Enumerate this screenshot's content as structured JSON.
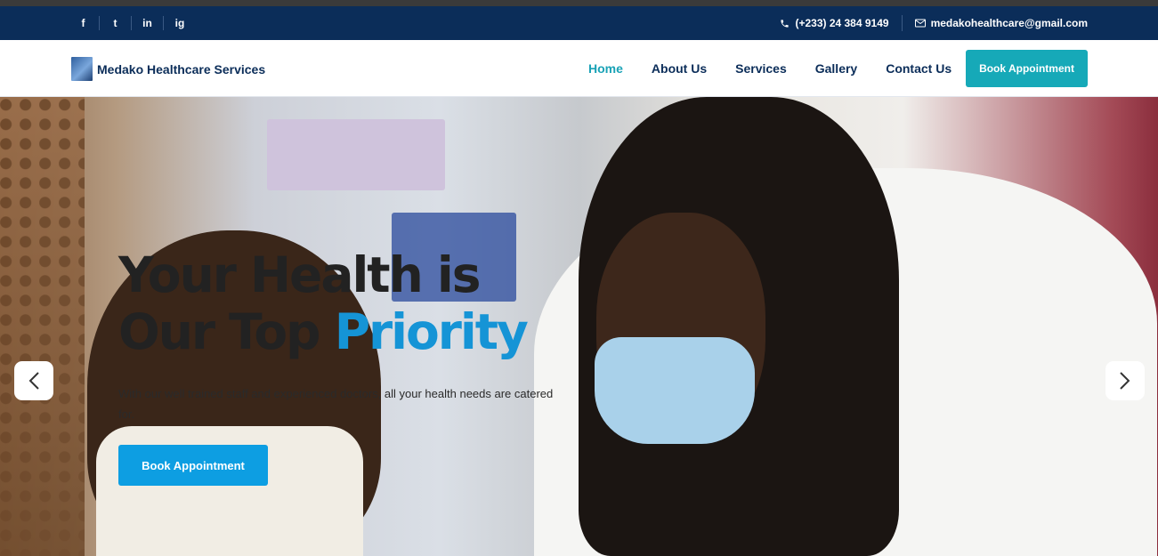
{
  "social": {
    "icons": [
      "facebook-icon",
      "twitter-icon",
      "linkedin-icon",
      "instagram-icon"
    ],
    "glyphs": [
      "f",
      "t",
      "in",
      "ig"
    ]
  },
  "contact": {
    "phone": "(+233) 24 384 9149",
    "email": "medakohealthcare@gmail.com"
  },
  "brand": {
    "name": "Medako Healthcare Services"
  },
  "nav": {
    "items": [
      "Home",
      "About Us",
      "Services",
      "Gallery",
      "Contact Us"
    ],
    "active": "Home",
    "cta": "Book Appointment"
  },
  "hero": {
    "title_line1": "Your Health is",
    "title_line2_start": "Our Top ",
    "title_line2_accent": "Priority",
    "subtitle": "With our well trained staff and experienced doctors, all your health needs are catered for.",
    "cta": "Book Appointment"
  },
  "colors": {
    "topbar": "#0b2d59",
    "nav_active": "#19a2b6",
    "nav_button": "#16a9b8",
    "hero_accent": "#1594d6",
    "hero_button": "#0d9ee2"
  }
}
